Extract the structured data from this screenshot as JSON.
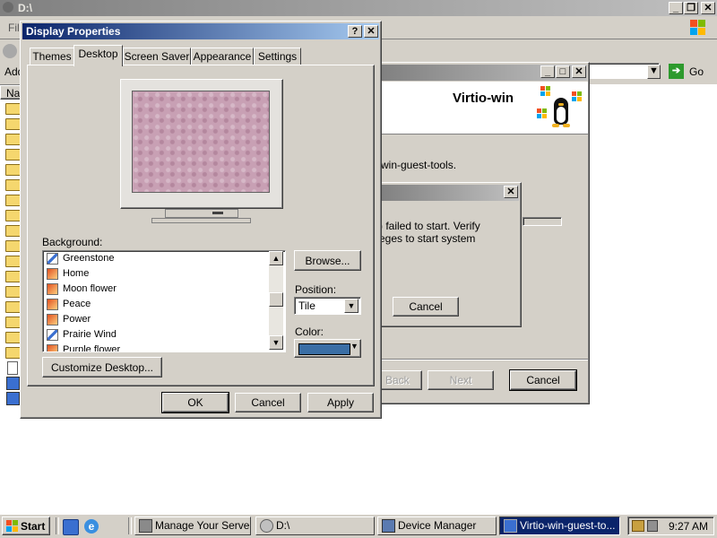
{
  "explorer": {
    "title": "D:\\",
    "menu_first_letter": "Fil",
    "address_label": "Add",
    "go_label": "Go",
    "column_name": "Nam"
  },
  "wizard": {
    "brand": "Virtio-win",
    "message": "win-guest-tools.",
    "back_label": "Back",
    "next_label": "Next",
    "cancel_label": "Cancel"
  },
  "error_dialog": {
    "line1": ") failed to start.  Verify",
    "line2": "eges to start system",
    "cancel_label": "Cancel"
  },
  "display_properties": {
    "title": "Display Properties",
    "tabs": [
      {
        "label": "Themes"
      },
      {
        "label": "Desktop"
      },
      {
        "label": "Screen Saver"
      },
      {
        "label": "Appearance"
      },
      {
        "label": "Settings"
      }
    ],
    "active_tab": "Desktop",
    "background_label": "Background:",
    "background_items": [
      {
        "label": "Greenstone",
        "icon": "bitmap-icon"
      },
      {
        "label": "Home",
        "icon": "image-icon"
      },
      {
        "label": "Moon flower",
        "icon": "image-icon"
      },
      {
        "label": "Peace",
        "icon": "image-icon"
      },
      {
        "label": "Power",
        "icon": "image-icon"
      },
      {
        "label": "Prairie Wind",
        "icon": "bitmap-icon"
      },
      {
        "label": "Purple flower",
        "icon": "image-icon"
      }
    ],
    "browse_label": "Browse...",
    "position_label": "Position:",
    "position_value": "Tile",
    "color_label": "Color:",
    "color_value": "#3a6ea5",
    "customize_label": "Customize Desktop...",
    "ok_label": "OK",
    "cancel_label": "Cancel",
    "apply_label": "Apply",
    "wallpaper_color": "#c8a0b4"
  },
  "taskbar": {
    "start_label": "Start",
    "buttons": [
      {
        "label": "Manage Your Server"
      },
      {
        "label": "D:\\"
      },
      {
        "label": "Device Manager"
      },
      {
        "label": "Virtio-win-guest-to..."
      }
    ],
    "clock": "9:27 AM"
  }
}
